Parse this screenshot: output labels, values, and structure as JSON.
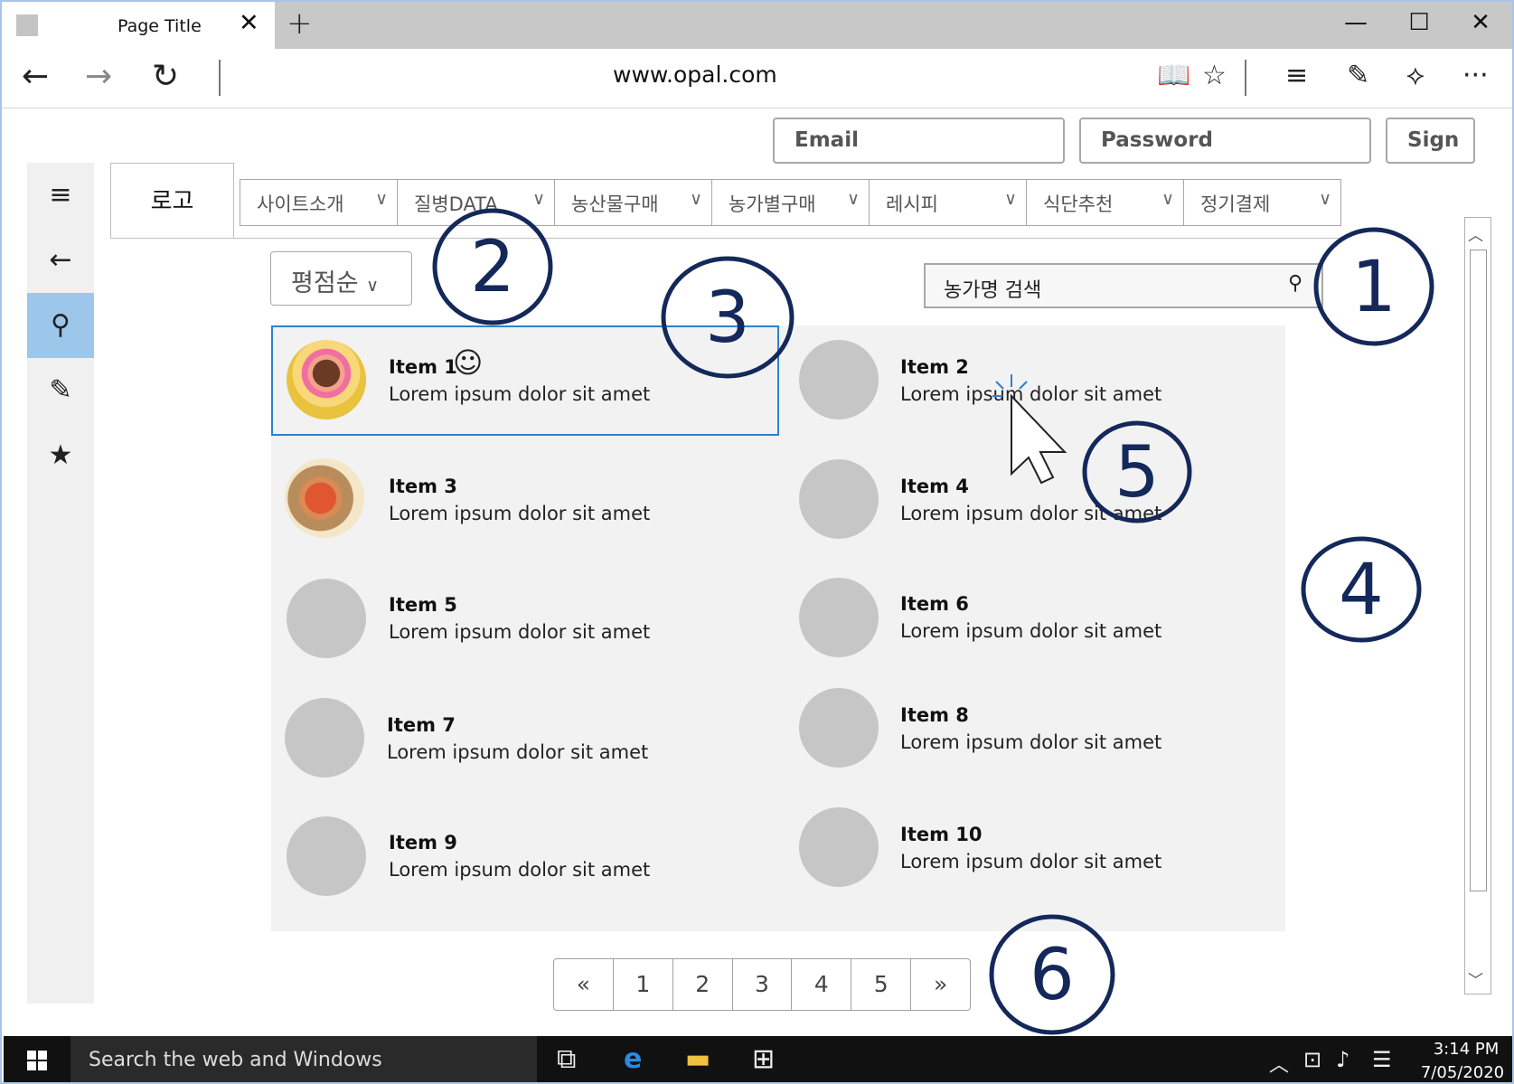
{
  "browser": {
    "tab_title": "Page Title",
    "close_glyph": "✕",
    "newtab_glyph": "+",
    "url": "www.opal.com",
    "window_controls": [
      "—",
      "☐",
      "✕"
    ],
    "nav": [
      "←",
      "→",
      "↻"
    ],
    "tools": [
      "📖",
      "☆",
      "≡",
      "✎",
      "⟡",
      "···"
    ]
  },
  "login": {
    "email_placeholder": "Email",
    "password_placeholder": "Password",
    "sign_label": "Sign"
  },
  "sidebar": {
    "items": [
      "≡",
      "←",
      "⚲",
      "✎",
      "★"
    ]
  },
  "logo": "로고",
  "menu": [
    "사이트소개",
    "질병DATA",
    "농산물구매",
    "농가별구매",
    "레시피",
    "식단추천",
    "정기결제"
  ],
  "menu_chevron": "∨",
  "sort": {
    "label": "평점순",
    "chevron": "∨"
  },
  "search": {
    "placeholder": "농가명 검색",
    "icon": "⚲"
  },
  "items": [
    {
      "title": "Item 1",
      "desc": "Lorem ipsum dolor sit amet"
    },
    {
      "title": "Item 2",
      "desc": "Lorem ipsum dolor sit amet"
    },
    {
      "title": "Item 3",
      "desc": "Lorem ipsum dolor sit amet"
    },
    {
      "title": "Item 4",
      "desc": "Lorem ipsum dolor sit amet"
    },
    {
      "title": "Item 5",
      "desc": "Lorem ipsum dolor sit amet"
    },
    {
      "title": "Item 6",
      "desc": "Lorem ipsum dolor sit amet"
    },
    {
      "title": "Item 7",
      "desc": "Lorem ipsum dolor sit amet"
    },
    {
      "title": "Item 8",
      "desc": "Lorem ipsum dolor sit amet"
    },
    {
      "title": "Item 9",
      "desc": "Lorem ipsum dolor sit amet"
    },
    {
      "title": "Item 10",
      "desc": "Lorem ipsum dolor sit amet"
    }
  ],
  "smiley": "☺",
  "pagination": [
    "«",
    "1",
    "2",
    "3",
    "4",
    "5",
    "»"
  ],
  "annotations": [
    "1",
    "2",
    "3",
    "4",
    "5",
    "6"
  ],
  "taskbar": {
    "search": "Search the web and Windows",
    "time": "3:14 PM",
    "date": "7/05/2020"
  },
  "colors": {
    "accent": "#2f80d0",
    "sidebar_active": "#9cc7ea",
    "annotation": "#14285a"
  }
}
